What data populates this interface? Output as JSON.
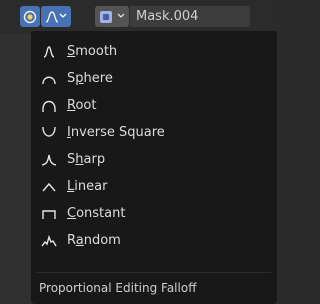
{
  "header": {
    "object_name": "Mask.004",
    "accent_color": "#4772b3"
  },
  "menu": {
    "items": [
      {
        "pre": "",
        "acc": "S",
        "post": "mooth",
        "icon": "smooth-falloff-icon"
      },
      {
        "pre": "",
        "acc": "",
        "post": "Sphere",
        "icon": "sphere-falloff-icon",
        "label_full": "Sphere"
      },
      {
        "pre": "",
        "acc": "R",
        "post": "oot",
        "icon": "root-falloff-icon"
      },
      {
        "pre": "",
        "acc": "I",
        "post": "nverse Square",
        "icon": "inverse-square-falloff-icon"
      },
      {
        "pre": "S",
        "acc": "h",
        "post": "arp",
        "icon": "sharp-falloff-icon"
      },
      {
        "pre": "",
        "acc": "L",
        "post": "inear",
        "icon": "linear-falloff-icon"
      },
      {
        "pre": "",
        "acc": "C",
        "post": "onstant",
        "icon": "constant-falloff-icon"
      },
      {
        "pre": "R",
        "acc": "a",
        "post": "ndom",
        "icon": "random-falloff-icon"
      }
    ],
    "title": "Proportional Editing Falloff"
  }
}
